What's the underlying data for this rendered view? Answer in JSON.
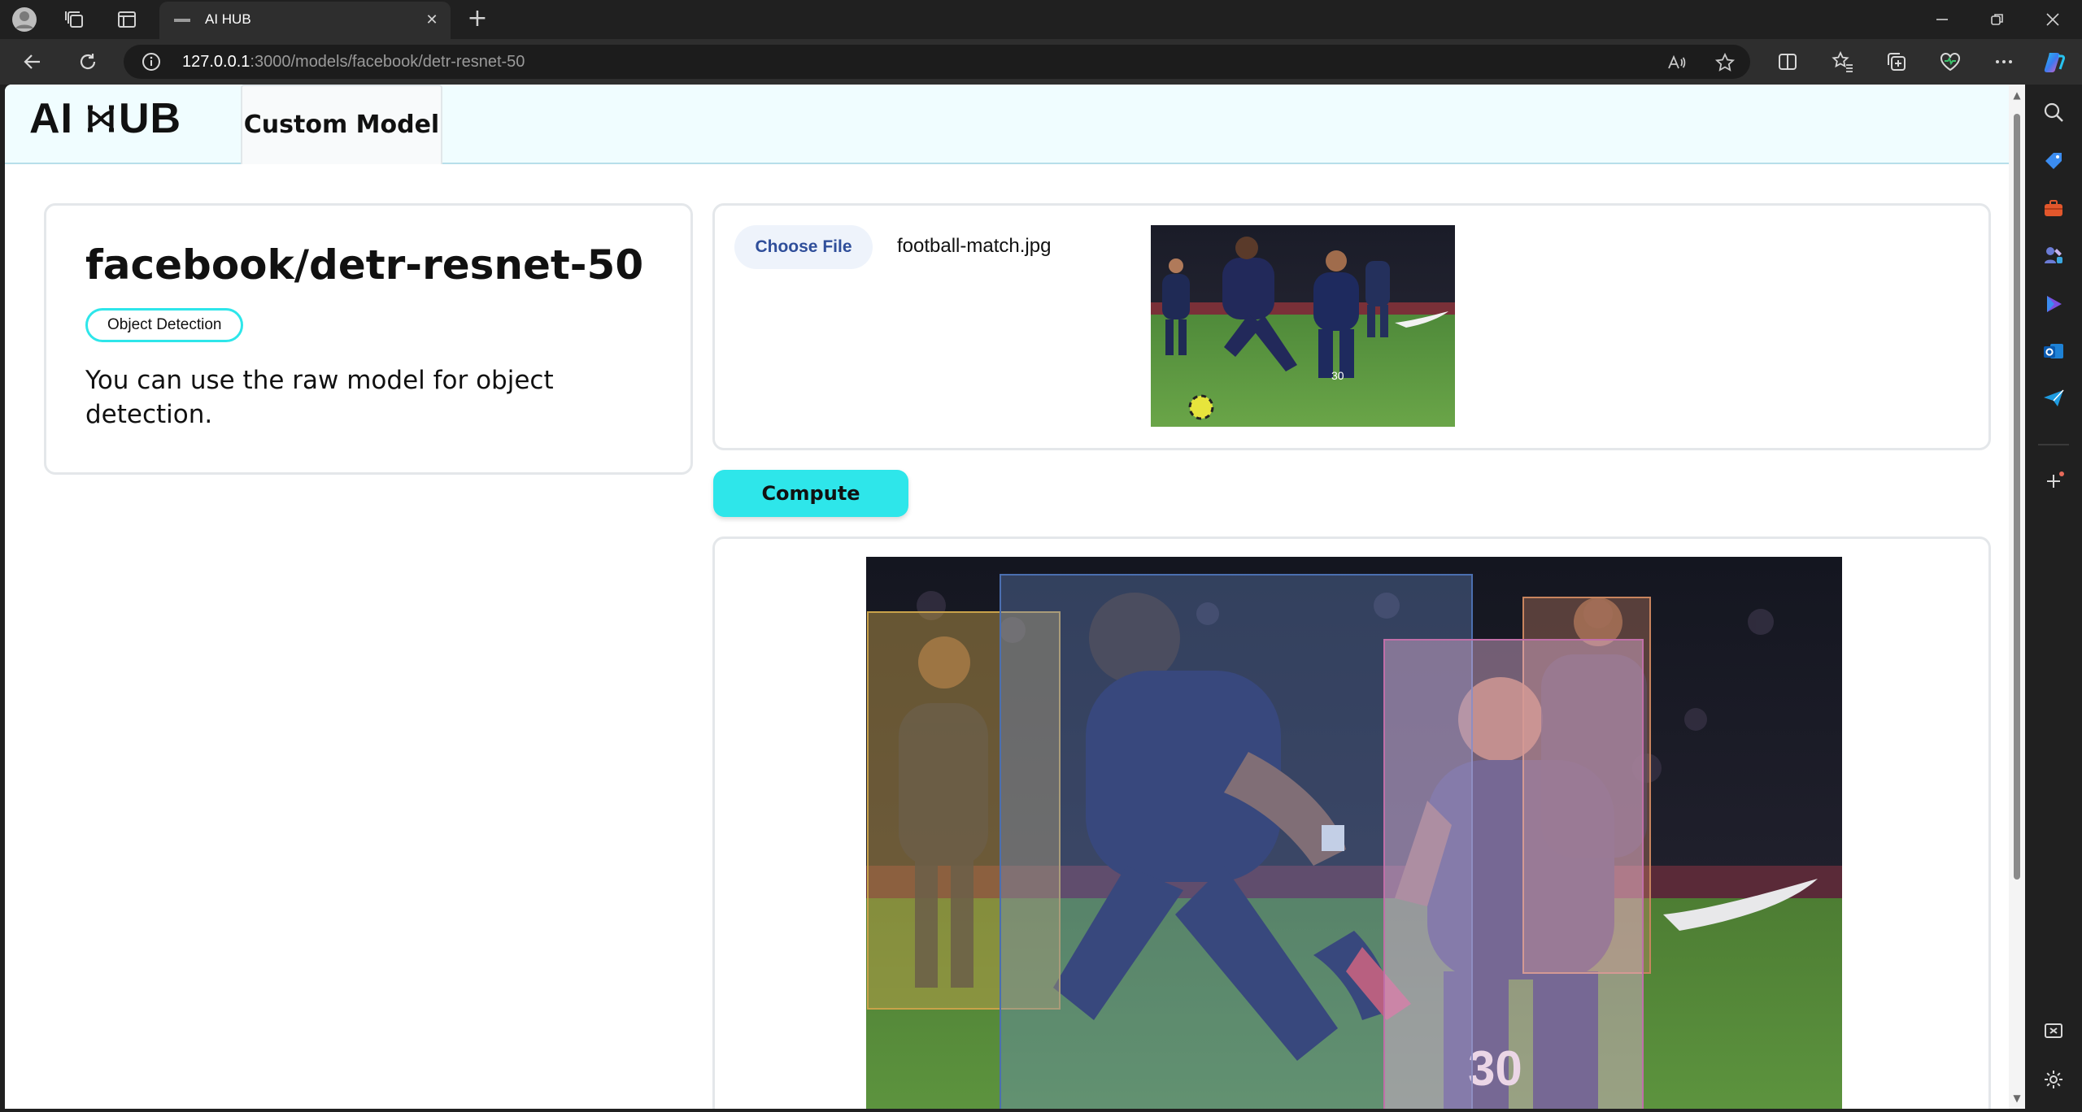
{
  "browser": {
    "tab_title": "AI HUB",
    "url_host": "127.0.0.1",
    "url_rest": ":3000/models/facebook/detr-resnet-50",
    "icons": [
      "profile-icon",
      "workspaces-icon",
      "tab-actions-icon",
      "back-icon",
      "refresh-icon",
      "info-icon",
      "read-aloud-icon",
      "favorite-icon",
      "split-screen-icon",
      "favorites-icon",
      "collections-icon",
      "health-icon",
      "more-icon",
      "copilot-icon"
    ]
  },
  "app": {
    "logo_left": "AI",
    "logo_right": "UB",
    "nav_tab": "Custom Model"
  },
  "model": {
    "name": "facebook/detr-resnet-50",
    "task_tag": "Object Detection",
    "description": "You can use the raw model for object detection."
  },
  "upload": {
    "choose_label": "Choose File",
    "file_name": "football-match.jpg"
  },
  "compute_label": "Compute",
  "detections": [
    {
      "color": "#c9a24a"
    },
    {
      "color": "#4b6fb0"
    },
    {
      "color": "#c06fa8"
    },
    {
      "color": "#c8845e"
    }
  ],
  "colors": {
    "accent": "#2ee6ea",
    "header_bg": "#f0fdff",
    "file_button_text": "#2f4e9a"
  }
}
